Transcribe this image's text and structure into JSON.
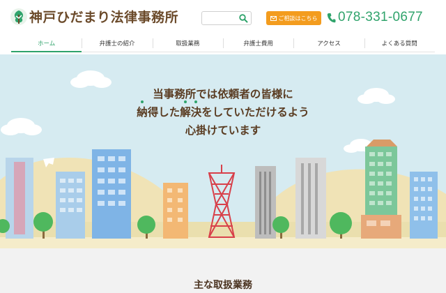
{
  "site": {
    "name": "神戸ひだまり法律事務所",
    "phone": "078-331-0677",
    "contact_label": "ご相談はこちら",
    "search_placeholder": ""
  },
  "nav": {
    "items": [
      {
        "label": "ホーム",
        "active": true
      },
      {
        "label": "弁護士の紹介"
      },
      {
        "label": "取扱業務"
      },
      {
        "label": "弁護士費用"
      },
      {
        "label": "アクセス"
      },
      {
        "label": "よくある質問"
      }
    ]
  },
  "hero": {
    "line1": "当事務所では依頼者の皆様に",
    "line2": {
      "a": "納",
      "b": "得した",
      "c": "解",
      "d": "決",
      "e": "をしていただけるよう"
    },
    "line3": "心掛けています"
  },
  "sections": {
    "main_services": "主な取扱業務"
  },
  "colors": {
    "brand_green": "#2fa36b",
    "accent_orange": "#f39c1e",
    "brown": "#5a3c22",
    "sky": "#d6ebf1"
  },
  "icons": [
    "logo-tree-icon",
    "search-icon",
    "mail-icon",
    "phone-icon"
  ]
}
